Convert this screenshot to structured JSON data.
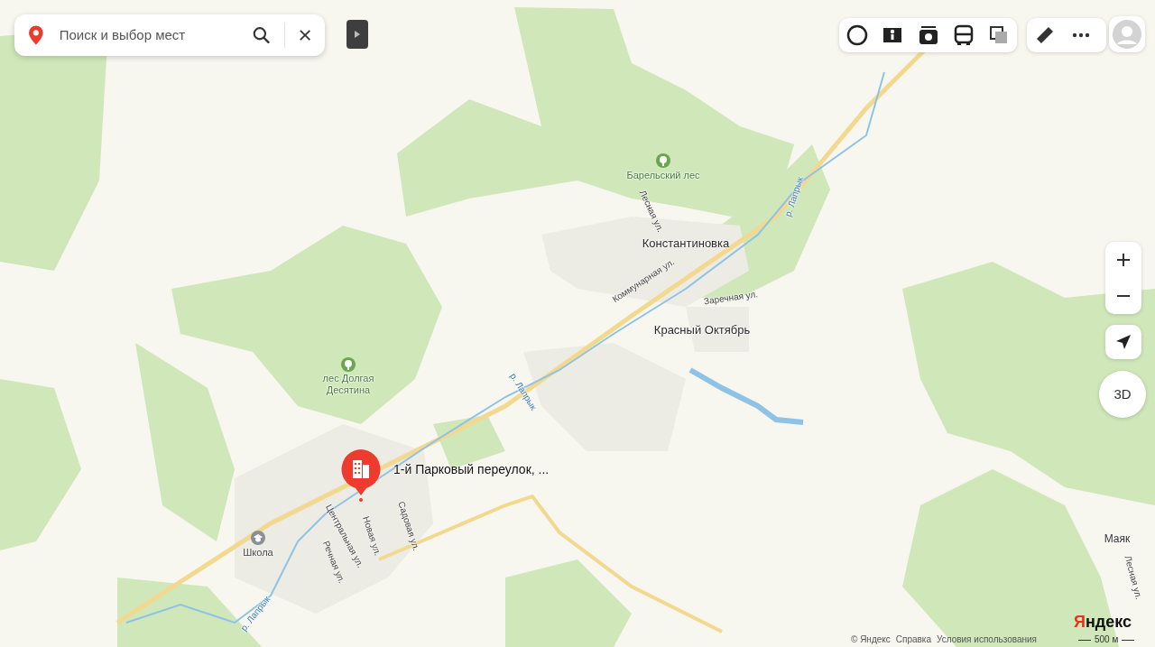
{
  "search": {
    "placeholder": "Поиск и выбор мест"
  },
  "map": {
    "labels": [
      {
        "text": "Барельский лес",
        "kind": "forest"
      },
      {
        "text": "лес Долгая Десятина",
        "kind": "forest"
      },
      {
        "text": "Константиновка",
        "kind": "settlement"
      },
      {
        "text": "Красный Октябрь",
        "kind": "settlement"
      },
      {
        "text": "Маяк",
        "kind": "village"
      },
      {
        "text": "Школа",
        "kind": "school"
      },
      {
        "text": "Лесная ул.",
        "kind": "street"
      },
      {
        "text": "Коммунарная ул.",
        "kind": "street"
      },
      {
        "text": "Заречная ул.",
        "kind": "street"
      },
      {
        "text": "Центральная ул.",
        "kind": "street"
      },
      {
        "text": "Новая ул.",
        "kind": "street"
      },
      {
        "text": "Садовая ул.",
        "kind": "street"
      },
      {
        "text": "Речная ул.",
        "kind": "street"
      },
      {
        "text": "Лесная ул.",
        "kind": "street"
      },
      {
        "text": "р. Лапрык",
        "kind": "river"
      },
      {
        "text": "р. Лапрык",
        "kind": "river"
      },
      {
        "text": "р. Лапрык",
        "kind": "river"
      }
    ],
    "pin": {
      "text": "1-й Парковый переулок, ..."
    }
  },
  "compass": {
    "label": "3D"
  },
  "footer": {
    "logo": "Яндекс",
    "links": [
      "© Яндекс",
      "Справка",
      "Условия использования"
    ],
    "scale": "500 м"
  }
}
